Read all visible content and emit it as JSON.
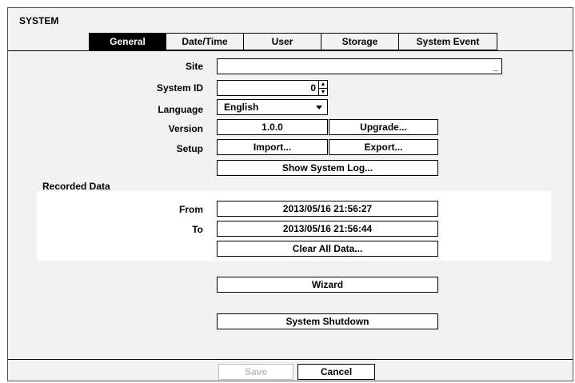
{
  "title": "SYSTEM",
  "tabs": [
    {
      "label": "General",
      "active": true
    },
    {
      "label": "Date/Time"
    },
    {
      "label": "User"
    },
    {
      "label": "Storage"
    },
    {
      "label": "System Event"
    }
  ],
  "general": {
    "site_label": "Site",
    "site_value": "",
    "site_cursor": "_",
    "system_id_label": "System ID",
    "system_id_value": "0",
    "language_label": "Language",
    "language_value": "English",
    "version_label": "Version",
    "version_value": "1.0.0",
    "upgrade_label": "Upgrade...",
    "setup_label": "Setup",
    "import_label": "Import...",
    "export_label": "Export...",
    "show_log_label": "Show System Log..."
  },
  "recorded": {
    "heading": "Recorded Data",
    "from_label": "From",
    "from_value": "2013/05/16  21:56:27",
    "to_label": "To",
    "to_value": "2013/05/16  21:56:44",
    "clear_label": "Clear All Data..."
  },
  "wizard_label": "Wizard",
  "shutdown_label": "System Shutdown",
  "footer": {
    "save_label": "Save",
    "cancel_label": "Cancel"
  }
}
